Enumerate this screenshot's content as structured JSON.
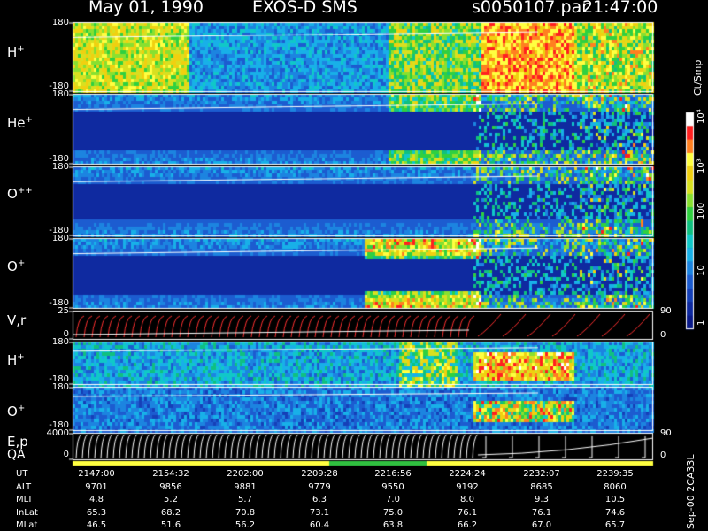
{
  "header": {
    "date": "May 01, 1990",
    "instrument": "EXOS-D SMS",
    "file": "s0050107.par",
    "time": "21:47:00"
  },
  "chart_data": {
    "type": "heatmap",
    "panels": [
      {
        "label": "H",
        "sup": "+",
        "ymax": "180",
        "ymin": "-180"
      },
      {
        "label": "He",
        "sup": "+",
        "ymax": "180",
        "ymin": "-180"
      },
      {
        "label": "O",
        "sup": "++",
        "ymax": "180",
        "ymin": "-180"
      },
      {
        "label": "O",
        "sup": "+",
        "ymax": "180",
        "ymin": "-180"
      },
      {
        "label": "V,r",
        "sup": "",
        "ymax": "25",
        "ymin": "0",
        "rmax": "90",
        "rmin": "0"
      },
      {
        "label": "H",
        "sup": "+",
        "ymax": "180",
        "ymin": "-180"
      },
      {
        "label": "O",
        "sup": "+",
        "ymax": "180",
        "ymin": "-180"
      },
      {
        "label": "E,p",
        "sup": "",
        "ymax": "4000",
        "ymin": "0",
        "rmax": "90",
        "rmin": "0"
      }
    ],
    "qa_label": "QA",
    "colorbar": {
      "unit": "Ct/Smp",
      "ticks": [
        "1",
        "10",
        "100",
        "10³",
        "10⁴"
      ],
      "scale": "log"
    },
    "ephemeris": {
      "rows": [
        {
          "name": "UT",
          "values": [
            "2147:00",
            "2154:32",
            "2202:00",
            "2209:28",
            "2216:56",
            "2224:24",
            "2232:07",
            "2239:35"
          ]
        },
        {
          "name": "ALT",
          "values": [
            "9701",
            "9856",
            "9881",
            "9779",
            "9550",
            "9192",
            "8685",
            "8060"
          ]
        },
        {
          "name": "MLT",
          "values": [
            "4.8",
            "5.2",
            "5.7",
            "6.3",
            "7.0",
            "8.0",
            "9.3",
            "10.5"
          ]
        },
        {
          "name": "InLat",
          "values": [
            "65.3",
            "68.2",
            "70.8",
            "73.1",
            "75.0",
            "76.1",
            "76.1",
            "74.6"
          ]
        },
        {
          "name": "MLat",
          "values": [
            "46.5",
            "51.6",
            "56.2",
            "60.4",
            "63.8",
            "66.2",
            "67.0",
            "65.7"
          ]
        }
      ]
    },
    "footer_note": "Sep-00 2CA33L",
    "colors": {
      "background": "#000000",
      "trace": "#ffffff",
      "vr_trace": "#ff3030",
      "qa_bar": "#ffff40",
      "qa_good": "#30c040"
    }
  }
}
